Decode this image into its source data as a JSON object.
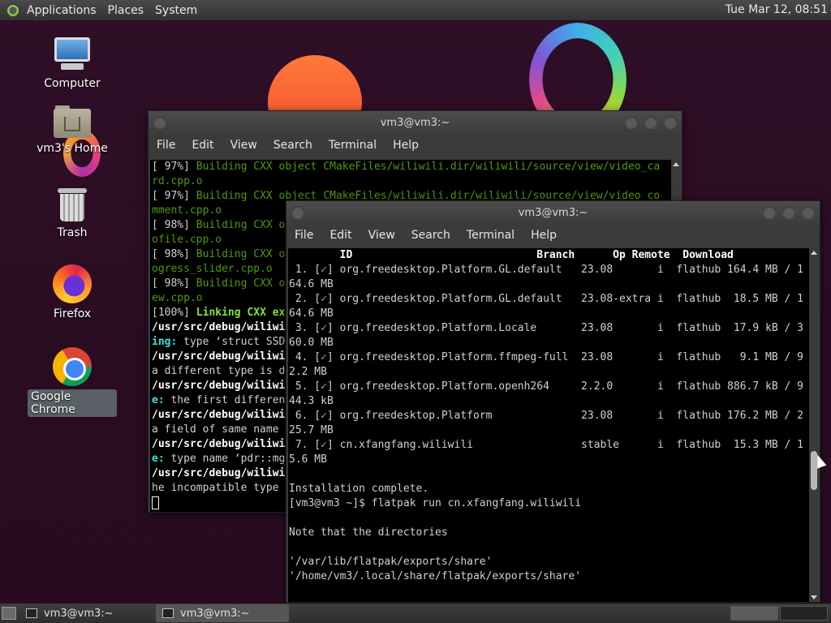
{
  "top_panel": {
    "menu": [
      "Applications",
      "Places",
      "System"
    ],
    "clock": "Tue Mar 12, 08:51"
  },
  "desktop_icons": [
    {
      "label": "Computer",
      "icon": "computer-icon"
    },
    {
      "label": "vm3's Home",
      "icon": "home-folder-icon"
    },
    {
      "label": "Trash",
      "icon": "trash-icon"
    },
    {
      "label": "Firefox",
      "icon": "firefox-icon"
    },
    {
      "label": "Google Chrome",
      "icon": "chrome-icon"
    }
  ],
  "back_window": {
    "title": "vm3@vm3:~",
    "menu": [
      "File",
      "Edit",
      "View",
      "Search",
      "Terminal",
      "Help"
    ],
    "lines": [
      {
        "prefix": "[ 97%] ",
        "text": "Building CXX object CMakeFiles/wiliwili.dir/wiliwili/source/view/video_ca"
      },
      {
        "prefix": "",
        "text": "rd.cpp.o"
      },
      {
        "prefix": "[ 97%] ",
        "text": "Building CXX object CMakeFiles/wiliwili.dir/wiliwili/source/view/video_co"
      },
      {
        "prefix": "",
        "text": "mment.cpp.o"
      },
      {
        "prefix": "[ 98%] ",
        "text": "Building CXX o"
      },
      {
        "prefix": "",
        "text": "ofile.cpp.o"
      },
      {
        "prefix": "[ 98%] ",
        "text": "Building CXX o"
      },
      {
        "prefix": "",
        "text": "ogress_slider.cpp.o"
      },
      {
        "prefix": "[ 98%] ",
        "text": "Building CXX o"
      },
      {
        "prefix": "",
        "text": "ew.cpp.o"
      },
      {
        "prefix": "[100%] ",
        "text": "Linking CXX ex"
      },
      {
        "bold": "/usr/src/debug/wiliwi"
      },
      {
        "cyan": "ing:",
        "rest": " type ‘struct SSD"
      },
      {
        "bold": "/usr/src/debug/wiliwi"
      },
      {
        "rest": "a different type is d"
      },
      {
        "bold": "/usr/src/debug/wiliwi"
      },
      {
        "cyan": "e:",
        "rest": " the first differen"
      },
      {
        "bold": "/usr/src/debug/wiliwi"
      },
      {
        "rest": "a field of same name "
      },
      {
        "bold": "/usr/src/debug/wiliwi"
      },
      {
        "cyan": "e:",
        "rest": " type name ‘pdr::mg"
      },
      {
        "bold": "/usr/src/debug/wiliwi"
      },
      {
        "rest": "he incompatible type "
      }
    ]
  },
  "front_window": {
    "title": "vm3@vm3:~",
    "menu": [
      "File",
      "Edit",
      "View",
      "Search",
      "Terminal",
      "Help"
    ],
    "lines": [
      "        ID                             Branch      Op Remote  Download",
      " 1. [✓] org.freedesktop.Platform.GL.default   23.08       i  flathub 164.4 MB / 1",
      "64.6 MB",
      " 2. [✓] org.freedesktop.Platform.GL.default   23.08-extra i  flathub  18.5 MB / 1",
      "64.6 MB",
      " 3. [✓] org.freedesktop.Platform.Locale       23.08       i  flathub  17.9 kB / 3",
      "60.0 MB",
      " 4. [✓] org.freedesktop.Platform.ffmpeg-full  23.08       i  flathub   9.1 MB / 9",
      "2.2 MB",
      " 5. [✓] org.freedesktop.Platform.openh264     2.2.0       i  flathub 886.7 kB / 9",
      "44.3 kB",
      " 6. [✓] org.freedesktop.Platform              23.08       i  flathub 176.2 MB / 2",
      "25.7 MB",
      " 7. [✓] cn.xfangfang.wiliwili                 stable      i  flathub  15.3 MB / 1",
      "5.6 MB",
      "",
      "Installation complete.",
      "[vm3@vm3 ~]$ flatpak run cn.xfangfang.wiliwili",
      "",
      "Note that the directories",
      "",
      "'/var/lib/flatpak/exports/share'",
      "'/home/vm3/.local/share/flatpak/exports/share'"
    ]
  },
  "taskbar": {
    "tasks": [
      "vm3@vm3:~",
      "vm3@vm3:~"
    ]
  }
}
